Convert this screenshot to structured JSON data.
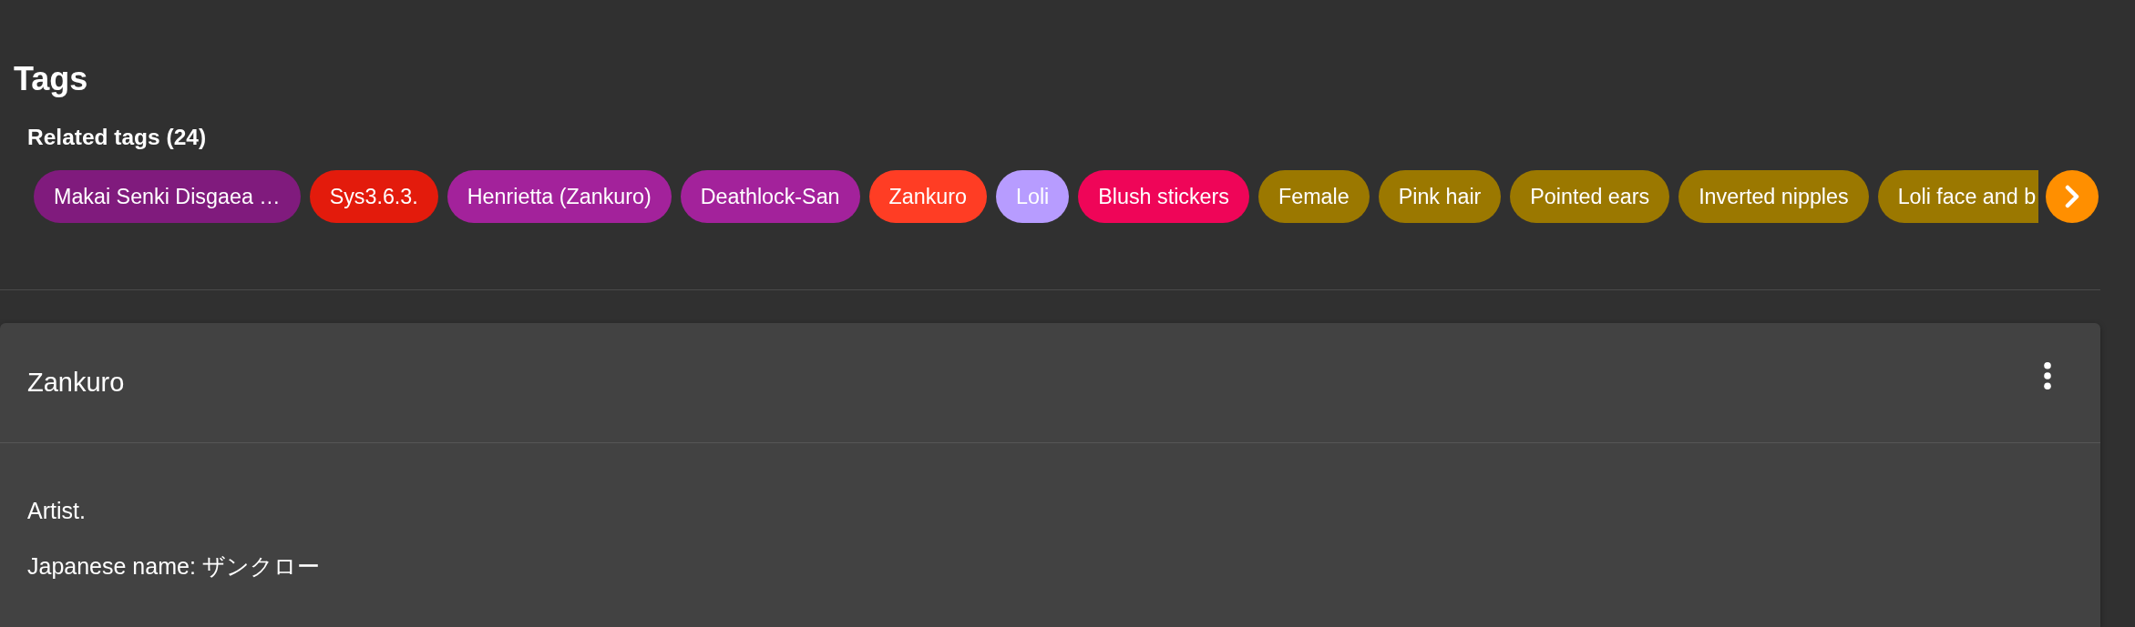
{
  "page_title": "Tags",
  "related_tags": {
    "heading": "Related tags (24)",
    "items": [
      {
        "label": "Makai Senki Disgaea …",
        "color": "#801b7d"
      },
      {
        "label": "Sys3.6.3.",
        "color": "#e31b0c"
      },
      {
        "label": "Henrietta (Zankuro)",
        "color": "#a3229b"
      },
      {
        "label": "Deathlock-San",
        "color": "#a3229b"
      },
      {
        "label": "Zankuro",
        "color": "#ff3d24"
      },
      {
        "label": "Loli",
        "color": "#b79cff"
      },
      {
        "label": "Blush stickers",
        "color": "#ef0558"
      },
      {
        "label": "Female",
        "color": "#9b7800"
      },
      {
        "label": "Pink hair",
        "color": "#9b7800"
      },
      {
        "label": "Pointed ears",
        "color": "#9b7800"
      },
      {
        "label": "Inverted nipples",
        "color": "#9b7800"
      },
      {
        "label": "Loli face and b",
        "color": "#9b7800"
      }
    ]
  },
  "card": {
    "title": "Zankuro",
    "paragraphs": [
      "Artist.",
      "Japanese name: ザンクロー"
    ]
  }
}
